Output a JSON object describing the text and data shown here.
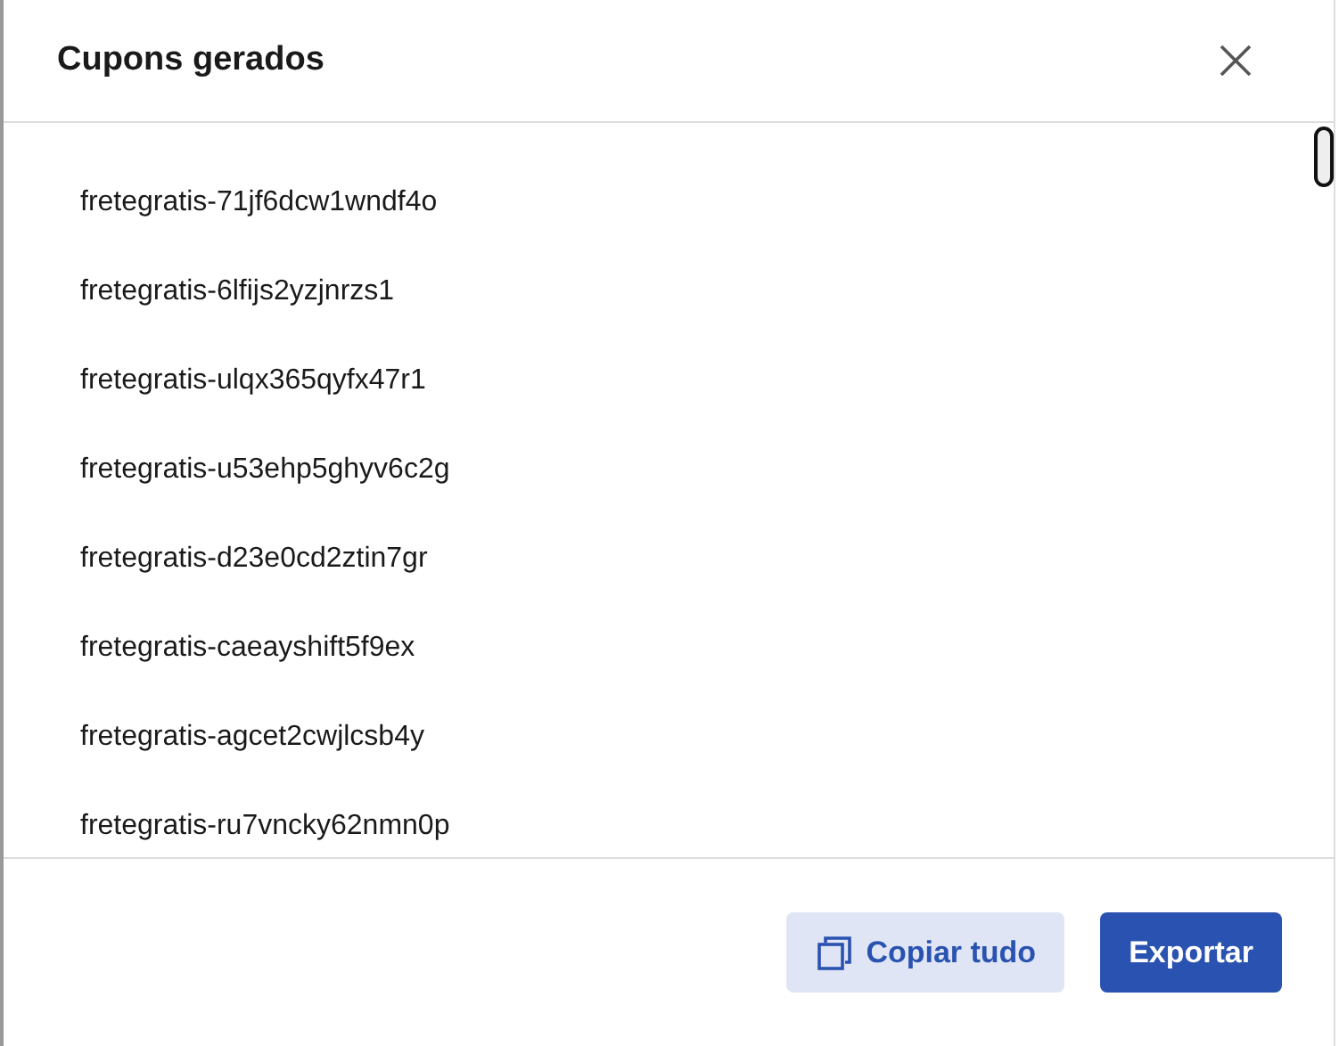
{
  "dialog": {
    "title": "Cupons gerados"
  },
  "coupons": [
    "fretegratis-71jf6dcw1wndf4o",
    "fretegratis-6lfijs2yzjnrzs1",
    "fretegratis-ulqx365qyfx47r1",
    "fretegratis-u53ehp5ghyv6c2g",
    "fretegratis-d23e0cd2ztin7gr",
    "fretegratis-caeayshift5f9ex",
    "fretegratis-agcet2cwjlcsb4y",
    "fretegratis-ru7vncky62nmn0p"
  ],
  "buttons": [
    {
      "kind": "secondary",
      "label": "Copiar tudo"
    },
    {
      "kind": "primary",
      "label": "Exportar"
    }
  ]
}
